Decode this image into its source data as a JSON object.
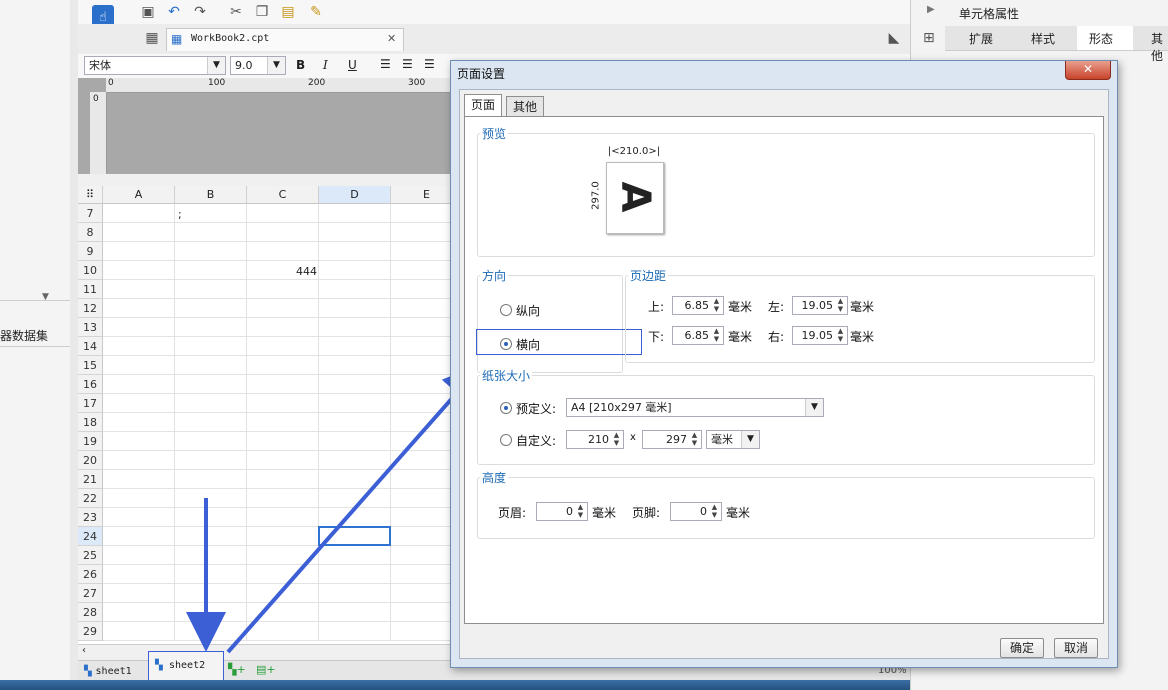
{
  "left_panel": {
    "dataset_label": "器数据集"
  },
  "toolbar": {
    "file_tab": "WorkBook2.cpt",
    "close_tab": "✕"
  },
  "format": {
    "font": "宋体",
    "size": "9.0",
    "bold": "B",
    "italic": "I",
    "underline": "U"
  },
  "ruler": {
    "marks": [
      "0",
      "100",
      "200",
      "300"
    ],
    "vmark": "0"
  },
  "grid": {
    "columns": [
      "A",
      "B",
      "C",
      "D",
      "E"
    ],
    "rows": [
      "7",
      "8",
      "9",
      "10",
      "11",
      "12",
      "13",
      "14",
      "15",
      "16",
      "17",
      "18",
      "19",
      "20",
      "21",
      "22",
      "23",
      "24",
      "25",
      "26",
      "27",
      "28",
      "29"
    ],
    "cell_b7": ";",
    "cell_c10": "444"
  },
  "sheets": [
    "sheet1",
    "sheet2"
  ],
  "right_panel": {
    "title": "单元格属性",
    "tabs": [
      "扩展",
      "样式",
      "形态",
      "其他"
    ]
  },
  "dialog": {
    "title": "页面设置",
    "close": "✕",
    "tabs": [
      "页面",
      "其他"
    ],
    "preview": {
      "label": "预览",
      "width": "210.0",
      "height": "297.0",
      "letter": "A"
    },
    "orientation": {
      "label": "方向",
      "portrait": "纵向",
      "landscape": "横向",
      "selected": "landscape"
    },
    "margin": {
      "label": "页边距",
      "top_label": "上:",
      "top": "6.85",
      "left_label": "左:",
      "left": "19.05",
      "bottom_label": "下:",
      "bottom": "6.85",
      "right_label": "右:",
      "right": "19.05",
      "unit": "毫米"
    },
    "paper": {
      "label": "纸张大小",
      "predefined_label": "预定义:",
      "predefined_value": "A4 [210x297 毫米]",
      "custom_label": "自定义:",
      "custom_w": "210",
      "custom_x": "x",
      "custom_h": "297",
      "custom_unit": "毫米",
      "selected": "predefined"
    },
    "height": {
      "label": "高度",
      "header_label": "页眉:",
      "header": "0",
      "footer_label": "页脚:",
      "footer": "0",
      "unit": "毫米"
    },
    "ok": "确定",
    "cancel": "取消"
  },
  "status": {
    "zoom": "100%"
  },
  "colors": {
    "accent": "#1c6ab4",
    "arrow": "#3d5fd6",
    "selection": "#2f73d1"
  }
}
